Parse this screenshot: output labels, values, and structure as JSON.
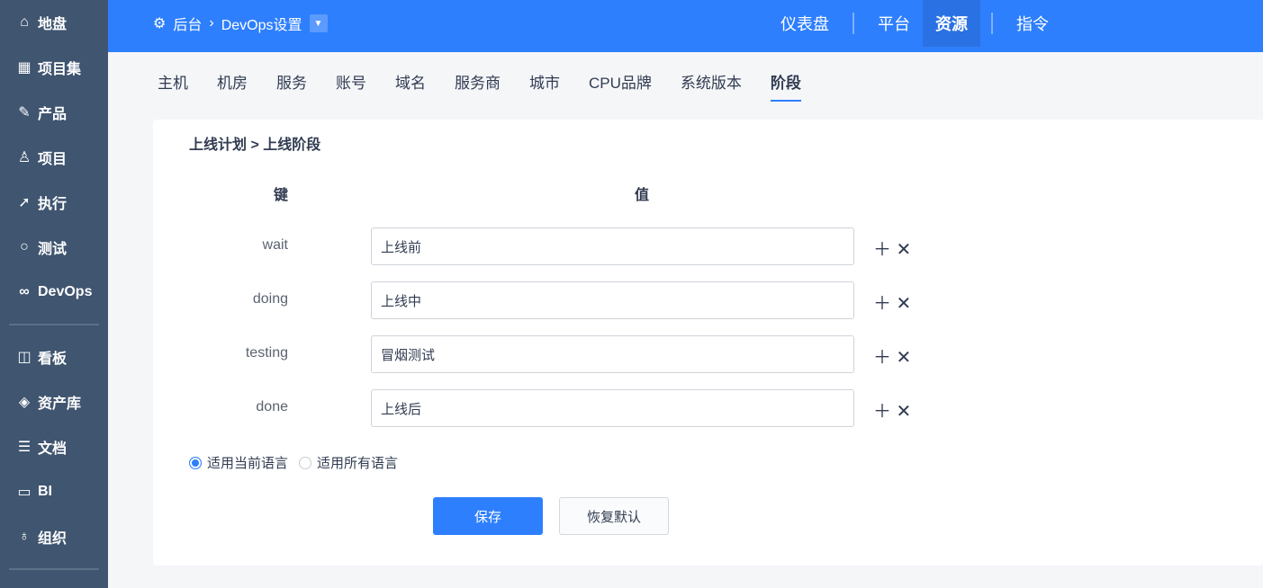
{
  "sidebar": {
    "items": [
      {
        "label": "地盘",
        "icon": "home-icon"
      },
      {
        "label": "项目集",
        "icon": "grid-icon"
      },
      {
        "label": "产品",
        "icon": "bulb-icon"
      },
      {
        "label": "项目",
        "icon": "rocket-icon"
      },
      {
        "label": "执行",
        "icon": "run-icon"
      },
      {
        "label": "测试",
        "icon": "search-icon"
      },
      {
        "label": "DevOps",
        "icon": "infinity-icon"
      },
      {
        "label": "看板",
        "icon": "kanban-icon"
      },
      {
        "label": "资产库",
        "icon": "diamond-icon"
      },
      {
        "label": "文档",
        "icon": "doc-icon"
      },
      {
        "label": "BI",
        "icon": "monitor-icon"
      },
      {
        "label": "组织",
        "icon": "users-icon"
      }
    ]
  },
  "header": {
    "crumb_root": "后台",
    "crumb_current": "DevOps设置",
    "nav": [
      "仪表盘",
      "平台",
      "资源",
      "指令"
    ],
    "active_nav": "资源"
  },
  "tabs": [
    "主机",
    "机房",
    "服务",
    "账号",
    "域名",
    "服务商",
    "城市",
    "CPU品牌",
    "系统版本",
    "阶段"
  ],
  "active_tab": "阶段",
  "form": {
    "title": "上线计划 > 上线阶段",
    "key_header": "键",
    "value_header": "值",
    "rows": [
      {
        "key": "wait",
        "value": "上线前"
      },
      {
        "key": "doing",
        "value": "上线中"
      },
      {
        "key": "testing",
        "value": "冒烟测试"
      },
      {
        "key": "done",
        "value": "上线后"
      }
    ],
    "radio_current": "适用当前语言",
    "radio_all": "适用所有语言",
    "save": "保存",
    "reset": "恢复默认"
  },
  "colors": {
    "primary": "#2e7ffd",
    "sidebar": "#3f5570"
  }
}
